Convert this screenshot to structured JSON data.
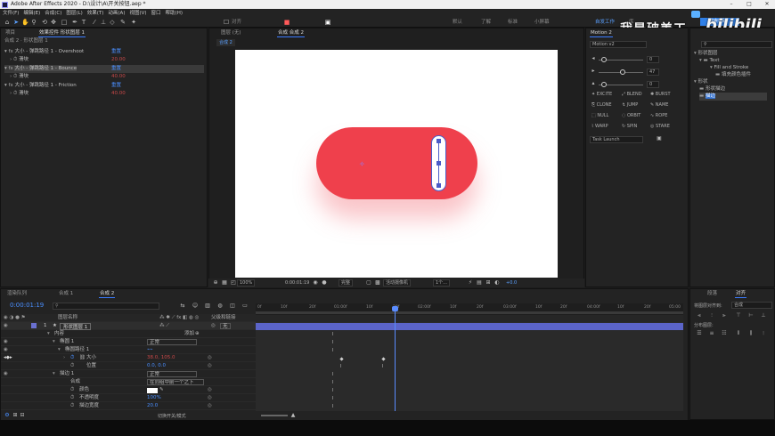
{
  "app": {
    "title": "Adobe After Effects 2020 - D:\\设计\\A\\开关按钮.aep *",
    "window_controls": [
      "–",
      "□",
      "✕"
    ]
  },
  "menu": [
    "文件(F)",
    "编辑(E)",
    "合成(C)",
    "图层(L)",
    "效果(T)",
    "动画(A)",
    "视图(V)",
    "窗口",
    "帮助(H)"
  ],
  "toolbar": {
    "align_label": "对齐",
    "workspaces": [
      "默认",
      "了解",
      "标准",
      "小屏幕",
      "自发工作",
      "库"
    ],
    "search_placeholder": "搜索帮助"
  },
  "watermark": {
    "text": "我是破美工",
    "logo": "bilibili"
  },
  "project_panel": {
    "tabs": [
      "项目",
      "效果控件 形状图层 1"
    ],
    "subtitle": "合成 2 · 形状图层 1",
    "effects": [
      {
        "name": "大小 - 弹跳路径 1 - Overshoot",
        "reset": "重置",
        "prop": "滑块",
        "value": "20.00"
      },
      {
        "name": "大小 - 弹跳路径 1 - Bounce",
        "reset": "重置",
        "prop": "滑块",
        "value": "40.00"
      },
      {
        "name": "大小 - 弹跳路径 1 - Friction",
        "reset": "重置",
        "prop": "滑块",
        "value": "40.00"
      }
    ]
  },
  "comp_panel": {
    "tabs": [
      "图层 (无)",
      "合成 合成 2"
    ],
    "breadcrumb": "合成 2",
    "zoom": "100%",
    "timecode": "0:00:01:19",
    "quality": "完整",
    "view": "活动摄像机",
    "views_count": "1个...",
    "offset": "+0.0"
  },
  "motion_panel": {
    "tab": "Motion 2",
    "select": "Motion v2",
    "sliders": [
      {
        "value": "0"
      },
      {
        "value": "47"
      },
      {
        "value": "0"
      }
    ],
    "buttons": [
      "EXCITE",
      "BLEND",
      "BURST",
      "CLONE",
      "JUMP",
      "NAME",
      "NULL",
      "ORBIT",
      "ROPE",
      "WARP",
      "SPIN",
      "STARE"
    ],
    "task": "Task Launch"
  },
  "library_panel": {
    "items": [
      "形状图层",
      "Text",
      "Fill and Stroke",
      "填充颜色插件",
      "形状",
      "形状描边",
      "描边"
    ]
  },
  "timeline": {
    "tabs": [
      "渲染队列",
      "合成 1",
      "合成 2"
    ],
    "timecode": "0:00:01:19",
    "col_layer_name": "图层名称",
    "col_parent": "父级和链接",
    "layer": {
      "index": "1",
      "name": "形状图层 1",
      "parent": "无"
    },
    "props": [
      {
        "indent": 1,
        "label": "内容",
        "value": "添加",
        "color": ""
      },
      {
        "indent": 2,
        "label": "椭圆 1",
        "value": "正常",
        "color": ""
      },
      {
        "indent": 3,
        "label": "椭圆路径 1",
        "value": "",
        "color": ""
      },
      {
        "indent": 4,
        "label": "大小",
        "value": "38.0, 105.0",
        "color": "red"
      },
      {
        "indent": 4,
        "label": "位置",
        "value": "0.0, 0.0",
        "color": "blue"
      },
      {
        "indent": 2,
        "label": "描边 1",
        "value": "正常",
        "color": ""
      },
      {
        "indent": 3,
        "label": "合成",
        "value": "在同组中前一个之下",
        "color": ""
      },
      {
        "indent": 3,
        "label": "颜色",
        "value": "",
        "color": ""
      },
      {
        "indent": 3,
        "label": "不透明度",
        "value": "100%",
        "color": "blue"
      },
      {
        "indent": 3,
        "label": "描边宽度",
        "value": "20.0",
        "color": "blue"
      }
    ],
    "ruler": [
      "0f",
      "10f",
      "20f",
      "01:00f",
      "10f",
      "20f",
      "02:00f",
      "10f",
      "20f",
      "03:00f",
      "10f",
      "20f",
      "04:00f",
      "10f",
      "20f",
      "05:00"
    ],
    "toggle_label": "切换开关/模式"
  },
  "align_panel": {
    "tabs": [
      "段落",
      "对齐"
    ],
    "align_to_label": "将图层对齐到:",
    "align_to_value": "合成",
    "distribute_label": "分布图层:"
  },
  "colors": {
    "accent": "#3b7cff",
    "pill": "#ef404c",
    "timeline_layer": "#5b64c8",
    "playhead": "#5a8cff"
  }
}
